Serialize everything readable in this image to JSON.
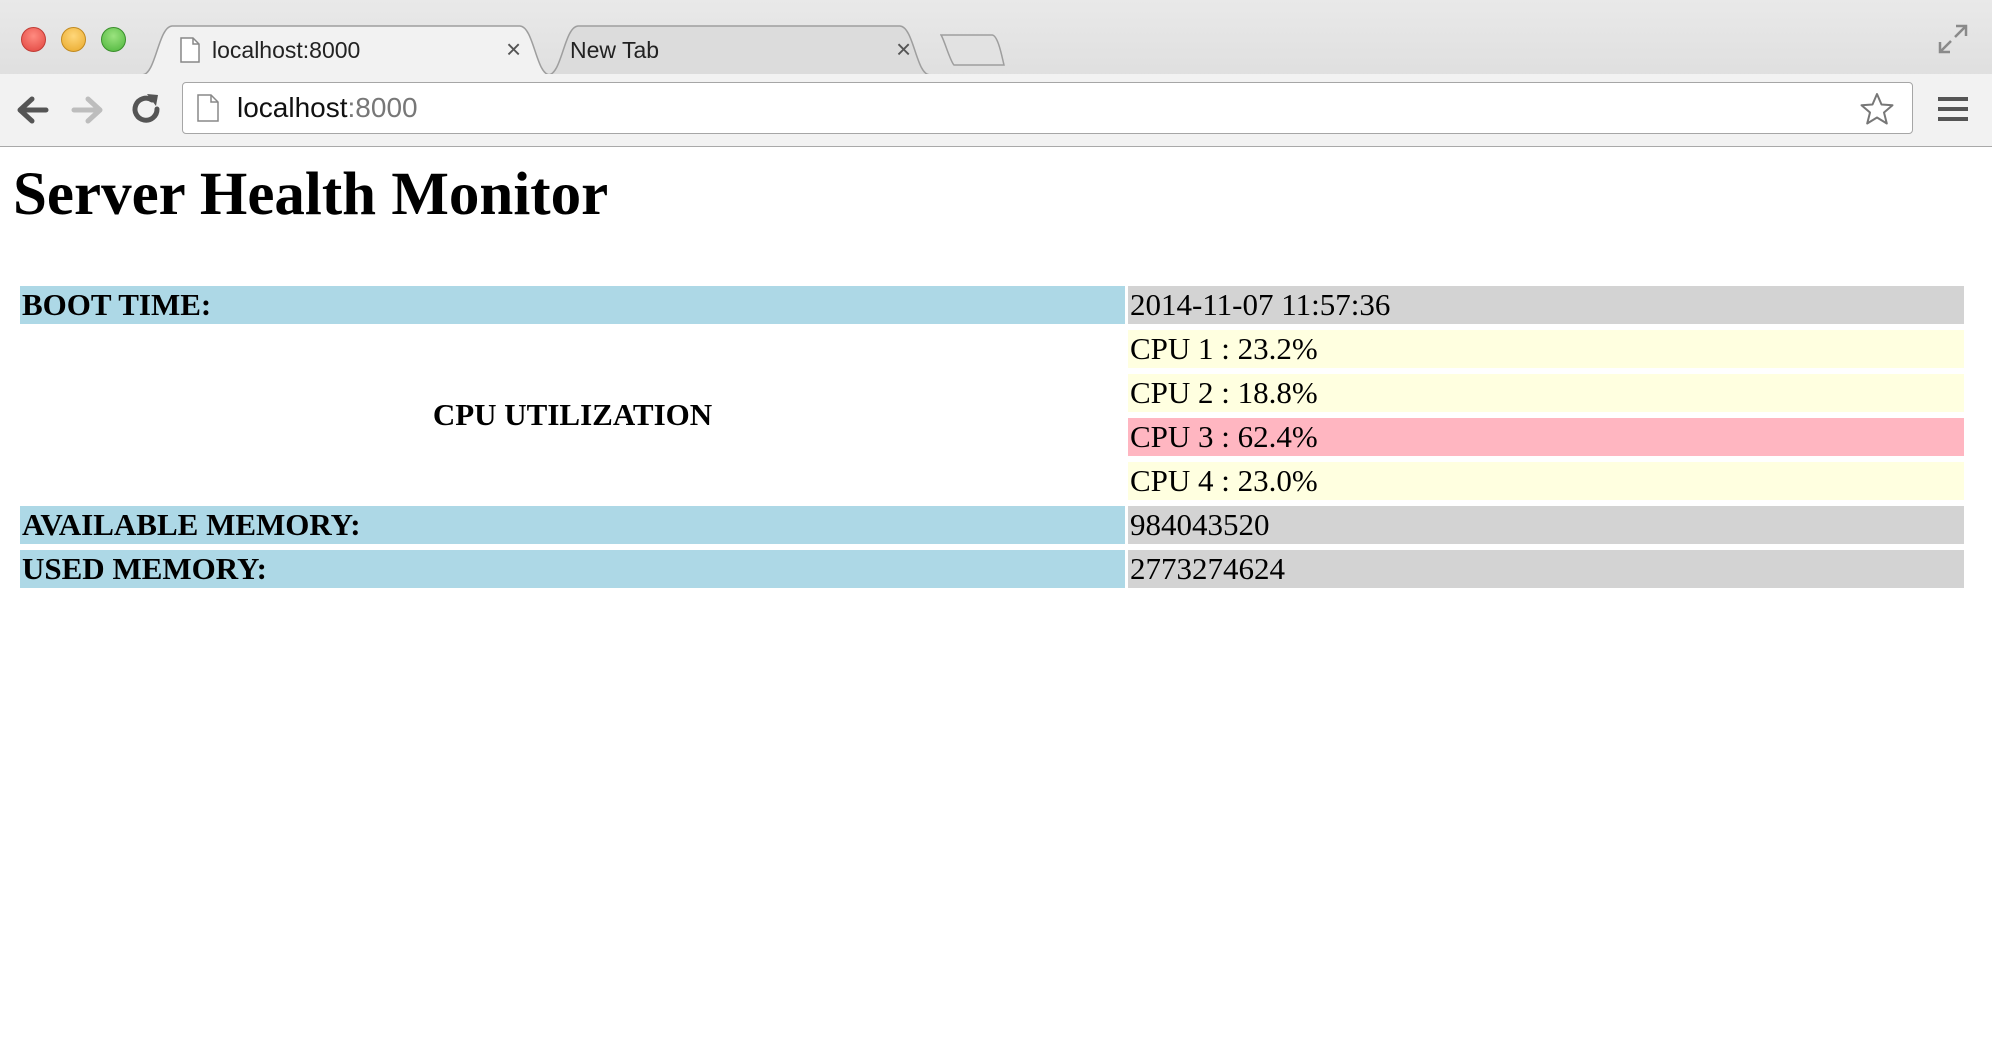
{
  "browser": {
    "tabs": [
      {
        "title": "localhost:8000",
        "close": "×",
        "active": true
      },
      {
        "title": "New Tab",
        "close": "×",
        "active": false
      }
    ],
    "address": {
      "host": "localhost",
      "port": ":8000"
    }
  },
  "page": {
    "title": "Server Health Monitor",
    "boot_time": {
      "label": "BOOT TIME:",
      "value": "2014-11-07 11:57:36"
    },
    "cpu": {
      "label": "CPU UTILIZATION",
      "cores": [
        {
          "text": "CPU 1 : 23.2%",
          "status": "normal"
        },
        {
          "text": "CPU 2 : 18.8%",
          "status": "normal"
        },
        {
          "text": "CPU 3 : 62.4%",
          "status": "high"
        },
        {
          "text": "CPU 4 : 23.0%",
          "status": "normal"
        }
      ]
    },
    "available_memory": {
      "label": "AVAILABLE MEMORY:",
      "value": "984043520"
    },
    "used_memory": {
      "label": "USED MEMORY:",
      "value": "2773274624"
    }
  },
  "colors": {
    "label_bg": "#add8e6",
    "value_bg": "#d3d3d3",
    "cpu_normal_bg": "#ffffe0",
    "cpu_high_bg": "#ffb6c1"
  },
  "icons": [
    "page-icon",
    "close-icon",
    "back-arrow-icon",
    "forward-arrow-icon",
    "reload-icon",
    "star-icon",
    "menu-icon",
    "fullscreen-icon"
  ]
}
